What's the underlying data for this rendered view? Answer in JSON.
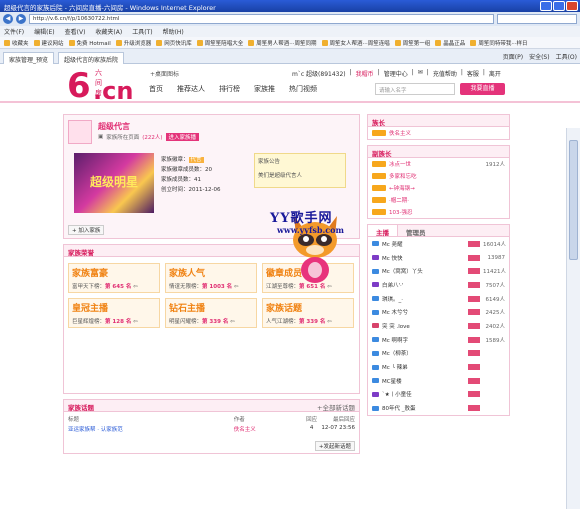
{
  "window": {
    "title": "超级代言的家族后院 - 六间房直播-六间房 - Windows Internet Explorer"
  },
  "address": {
    "url": "http://v.6.cn/f/p/10630722.html"
  },
  "menu": [
    "文件(F)",
    "编辑(E)",
    "查看(V)",
    "收藏夹(A)",
    "工具(T)",
    "帮助(H)"
  ],
  "favorites": [
    "收藏夹",
    "建议网站",
    "免费 Hotmail",
    "升级浏览器",
    "网页快讯库",
    "周笙笙陪唱大全",
    "周笙男人帮酒···周笙同期",
    "周笙女人帮酒···周笙连唱",
    "周笙第一组",
    "晶晶正品",
    "周笙同特带我···样日"
  ],
  "tabs": {
    "active": "家族管理_预览",
    "second": "超级代言的家族后院",
    "tools": [
      "页面(P)",
      "安全(S)",
      "工具(O)"
    ]
  },
  "site": {
    "logo_brand": "六间房",
    "logo_six": "6",
    "logo_cn": ".cn",
    "home_link": "+桌面图标",
    "nav": [
      "首页",
      "推荐达人",
      "排行榜",
      "家族推",
      "热门视频"
    ],
    "user": {
      "name": "m`c 超级(891432)",
      "charge": "我帽币",
      "manage": "管理中心",
      "message": "",
      "support": "充值帮助",
      "help": "客服",
      "logout": "离开"
    },
    "search_placeholder": "请输入名字",
    "live_button": "我要直播"
  },
  "family": {
    "name": "超级代言",
    "owner_line": "家族所在页面",
    "member_count": "(222人)",
    "join_btn": "进入家族播",
    "badge_label": "家族徽章：",
    "badge_tag": "代言",
    "banner_text": "超级明星",
    "stats": [
      "家族徽章成员数：20",
      "家族成员数：41",
      "创立时间：2011-12-06"
    ],
    "notice_title": "家族公告",
    "notice_text": "美们是超级代言人",
    "join_link": "加入家族"
  },
  "honor": {
    "title": "家族荣誉",
    "cards": [
      {
        "head": "家族富豪",
        "label": "富甲天下榜：",
        "rank": "第 645 名"
      },
      {
        "head": "家族人气",
        "label": "情谊无限榜：",
        "rank": "第 1003 名"
      },
      {
        "head": "徽章成员",
        "label": "江湖至尊榜：",
        "rank": "第 651 名"
      },
      {
        "head": "皇冠主播",
        "label": "巨星辉煌榜：",
        "rank": "第 128 名"
      },
      {
        "head": "钻石主播",
        "label": "明星闪耀榜：",
        "rank": "第 339 名"
      },
      {
        "head": "家族话题",
        "label": "人气江湖榜：",
        "rank": "第 339 名"
      }
    ]
  },
  "topics": {
    "title": "家族话题",
    "more": "+全部新话题",
    "headers": [
      "标题",
      "作者",
      "回应",
      "最后回应"
    ],
    "rows": [
      {
        "title": "亚运家族帮 · 认家族范",
        "author": "佚名主义",
        "replies": "4",
        "last": "12-07 23:56"
      }
    ],
    "new_btn": "+发起新话题"
  },
  "watermark": {
    "line1": "YY歌手网",
    "line2": "www.yyfsb.com"
  },
  "right": {
    "leader_title": "族长",
    "leader": "佚名主义",
    "vice_title": "副族长",
    "vices": [
      {
        "name": "冰点一世",
        "count": "1912人"
      },
      {
        "name": "多家和忘吃",
        "count": ""
      },
      {
        "name": "←钟海钢→",
        "count": ""
      },
      {
        "name": "·帽二期·",
        "count": ""
      },
      {
        "name": "103-强忍",
        "count": ""
      }
    ],
    "tab_on": "主播",
    "tab_off": "管理员",
    "members": [
      {
        "name": "Mc 尧耀",
        "count": "16014人",
        "color": "#3c8ae0"
      },
      {
        "name": "Mc 快快",
        "count": "13987",
        "color": "#7d3cc6"
      },
      {
        "name": "Mc（窝窝）丫头",
        "count": "11421人",
        "color": "#3c8ae0"
      },
      {
        "name": "白弟八'·'",
        "count": "7507人",
        "color": "#7d3cc6"
      },
      {
        "name": "琪琪。_·",
        "count": "6149人",
        "color": "#3c8ae0"
      },
      {
        "name": "Mc 木兮兮",
        "count": "2425人",
        "color": "#3c8ae0"
      },
      {
        "name": "突 突 .love",
        "count": "2402人",
        "color": "#d7436b"
      },
      {
        "name": "Mc 啊啊字",
        "count": "1589人",
        "color": "#3c8ae0"
      },
      {
        "name": "Mc（柳茶）",
        "count": "",
        "color": "#3c8ae0"
      },
      {
        "name": "Mc ╰ 辣弟",
        "count": "",
        "color": "#3c8ae0"
      },
      {
        "name": "MC星楼",
        "count": "",
        "color": "#3c8ae0"
      },
      {
        "name": "`★丨小童佳",
        "count": "",
        "color": "#7d3cc6"
      },
      {
        "name": "80年代 _敖蛋",
        "count": "",
        "color": "#3c8ae0"
      }
    ]
  }
}
